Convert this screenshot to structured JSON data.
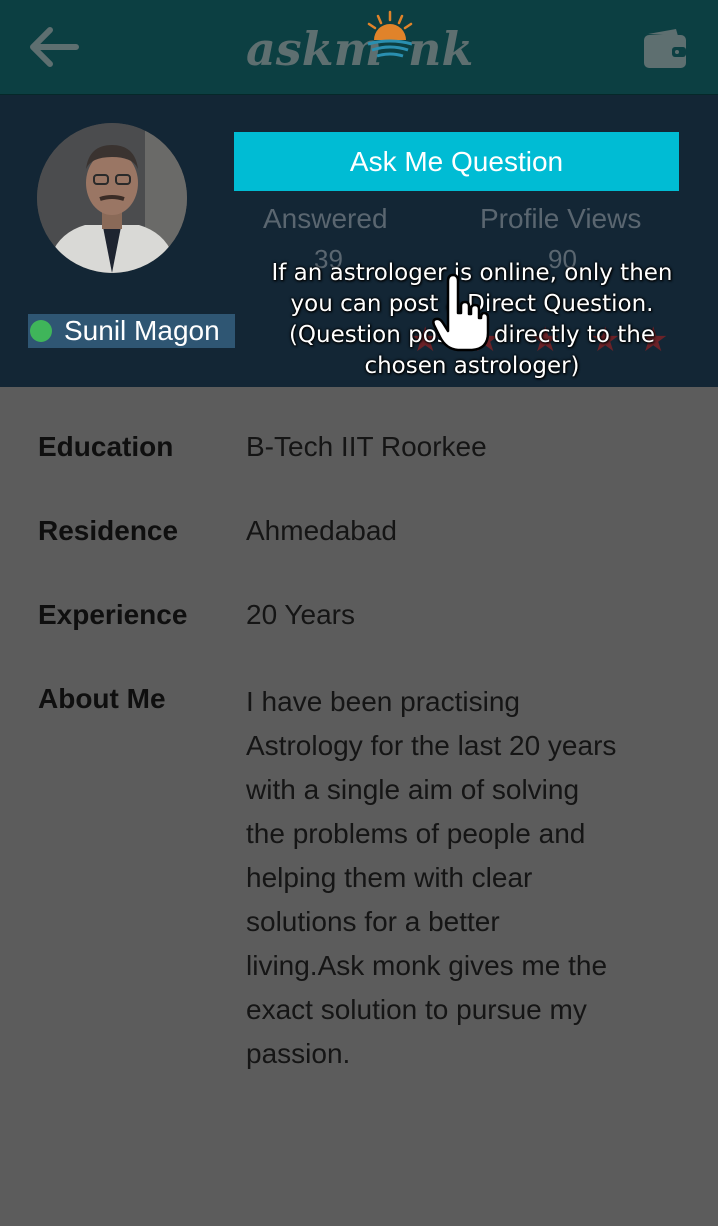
{
  "header": {
    "logo_text_left": "askm",
    "logo_text_right": "nk",
    "back_icon": "back-arrow-icon",
    "wallet_icon": "wallet-icon",
    "bar_color": "#0c3f42"
  },
  "profile": {
    "name": "Sunil Magon",
    "online": true,
    "ask_button_label": "Ask Me Question",
    "answered_label": "Answered",
    "answered_count": "39",
    "views_label": "Profile Views",
    "views_count": "90",
    "rating_stars": 5,
    "accent_color": "#00bcd4"
  },
  "tooltip": {
    "line1": "If an astrologer is online, only then",
    "line2": "you can post a Direct Question.",
    "line3": "(Question posted directly to the",
    "line4": "chosen astrologer)"
  },
  "details": {
    "education_label": "Education",
    "education_value": "B-Tech IIT Roorkee",
    "residence_label": "Residence",
    "residence_value": "Ahmedabad",
    "experience_label": "Experience",
    "experience_value": "20 Years",
    "about_label": "About Me",
    "about_lines": [
      "I have been practising",
      "Astrology for the last 20 years",
      "with a single aim of solving",
      "the problems of people and",
      "helping them with clear",
      "solutions for a better",
      "living.Ask monk gives me the",
      "exact solution to pursue my",
      "passion."
    ]
  }
}
